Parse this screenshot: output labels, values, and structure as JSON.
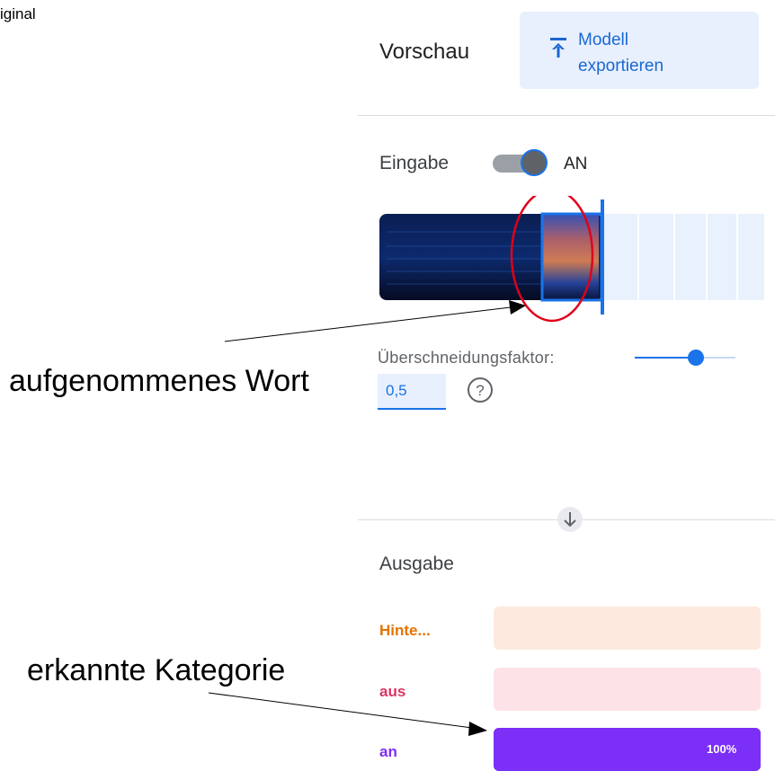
{
  "corner_label": "iginal",
  "header": {
    "title": "Vorschau",
    "export_button": {
      "label_line1": "Modell",
      "label_line2": "exportieren",
      "icon": "upload-icon"
    }
  },
  "input": {
    "label": "Eingabe",
    "toggle_state": "AN",
    "toggle_on": true,
    "overlap": {
      "label": "Überschneidungsfaktor:",
      "value": "0,5",
      "slider_fraction": 0.6
    },
    "help_icon": "help-circle-icon"
  },
  "output": {
    "label": "Ausgabe",
    "classes": [
      {
        "name": "Hinte...",
        "color": "#e37400",
        "bg": "#fde9dd",
        "fraction": 0
      },
      {
        "name": "aus",
        "color": "#d93663",
        "bg": "#fde3e7",
        "fraction": 0
      },
      {
        "name": "an",
        "color": "#7b2ff7",
        "bg": "#7b2ff7",
        "fraction": 1.0,
        "percent_label": "100%"
      }
    ]
  },
  "annotations": {
    "recorded_word": "aufgenommenes Wort",
    "detected_category": "erkannte Kategorie"
  },
  "colors": {
    "accent": "#1a73e8",
    "highlight_circle": "#e0001a"
  }
}
